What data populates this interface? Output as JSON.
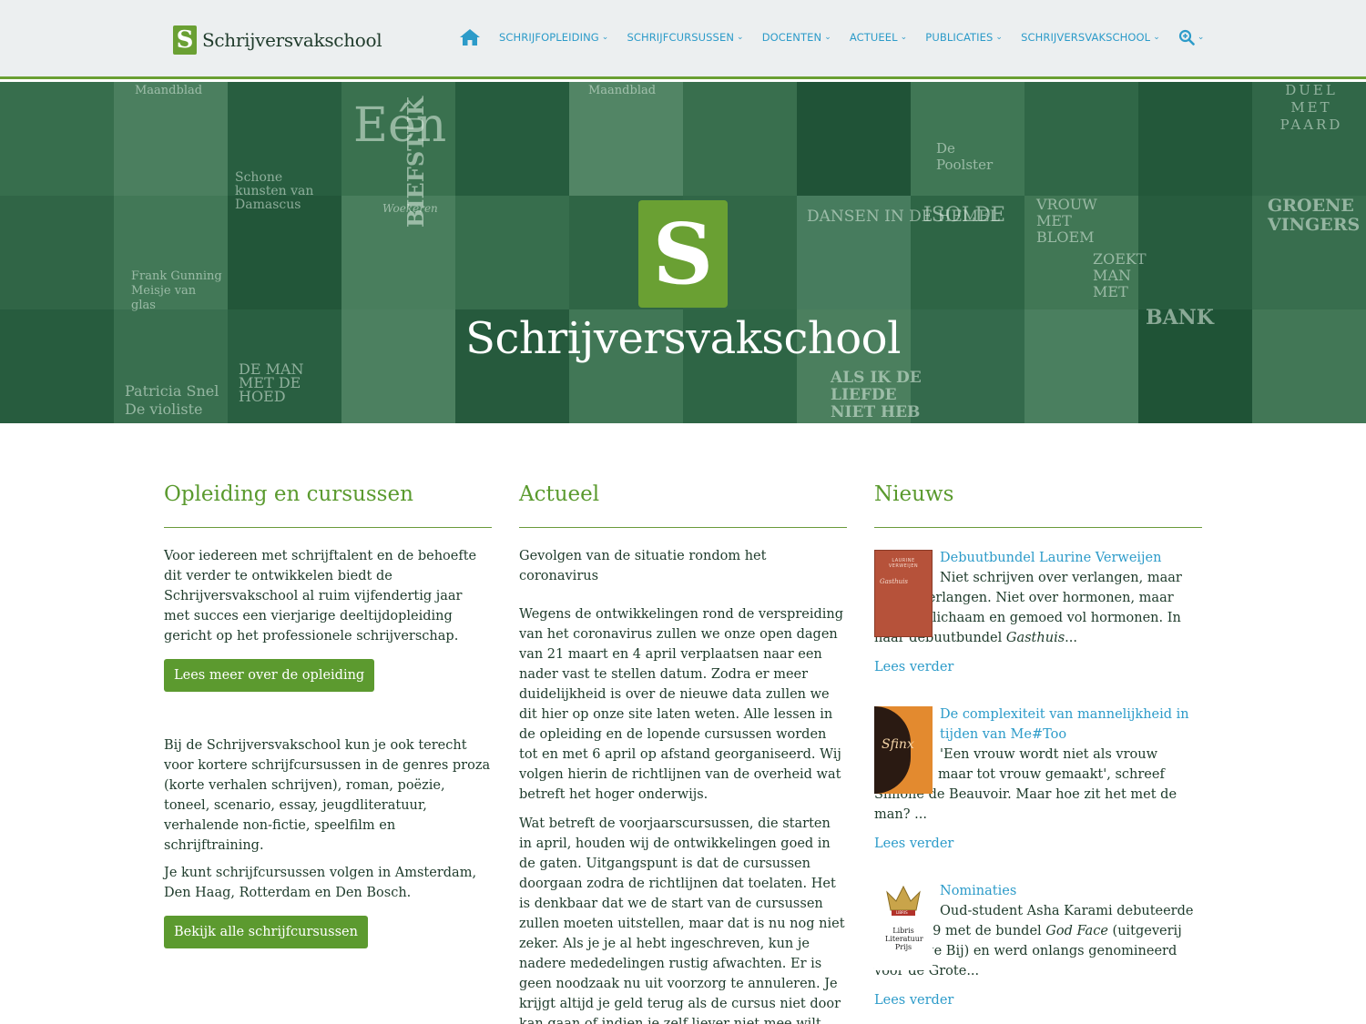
{
  "header": {
    "logo_letter": "S",
    "logo_text": "Schrijversvakschool",
    "nav": [
      {
        "label": "SCHRIJFOPLEIDING"
      },
      {
        "label": "SCHRIJFCURSUSSEN"
      },
      {
        "label": "DOCENTEN"
      },
      {
        "label": "ACTUEEL"
      },
      {
        "label": "PUBLICATIES"
      },
      {
        "label": "SCHRIJVERSVAKSCHOOL"
      }
    ]
  },
  "hero": {
    "logo_letter": "S",
    "title": "Schrijversvakschool",
    "tile_texts": [
      "Maandblad",
      "Eén",
      "Maandblad",
      "Schone kunsten van Damascus",
      "De Poolster",
      "DUEL MET PAARD",
      "Woekeren",
      "BIEFSTUK",
      "DANSEN IN DE HEMEL",
      "ISOLDE",
      "VROUW MET BLOEM",
      "GROENE VINGERS",
      "Frank Gunning Meisje van glas",
      "ZOEKT MAN MET",
      "BANK",
      "Patricia Snel De violiste",
      "DE MAN MET DE HOED",
      "ALS IK DE LIEFDE NIET HEB"
    ]
  },
  "col1": {
    "heading": "Opleiding en cursussen",
    "p1": "Voor iedereen met schrijftalent en de behoefte dit verder te ontwikkelen biedt de Schrijversvakschool al ruim vijfendertig jaar met succes een vierjarige deeltijdopleiding gericht op het professionele schrijverschap.",
    "btn1": "Lees meer over de opleiding",
    "p2": "Bij de Schrijversvakschool kun je ook terecht voor kortere schrijfcursussen in de genres proza (korte verhalen schrijven), roman, poëzie, toneel, scenario, essay, jeugdliteratuur, verhalende non-fictie, speelfilm en schrijftraining.",
    "p3": "Je kunt schrijfcursussen volgen in Amsterdam, Den Haag, Rotterdam en Den Bosch.",
    "btn2": "Bekijk alle schrijfcursussen"
  },
  "col2": {
    "heading": "Actueel",
    "p1": "Gevolgen van de situatie rondom het coronavirus",
    "p2": "Wegens de ontwikkelingen rond de verspreiding van het coronavirus zullen we onze open dagen van 21 maart en 4 april verplaatsen naar een nader vast te stellen datum. Zodra er meer duidelijkheid is over de nieuwe data zullen we dit hier op onze site laten weten. Alle lessen in de opleiding en de lopende cursussen worden tot en met 6 april op afstand georganiseerd. Wij volgen hierin de richtlijnen van de overheid wat betreft het hoger onderwijs.",
    "p3": "Wat betreft de voorjaarscursussen, die starten in april, houden wij de ontwikkelingen goed in de gaten. Uitgangspunt is dat de cursussen doorgaan zodra de richtlijnen dat toelaten. Het is denkbaar dat we de start van de cursussen zullen moeten uitstellen, maar dat is nu nog niet zeker. Als je je al hebt ingeschreven, kun je nadere mededelingen rustig afwachten. Er is geen noodzaak nu uit voorzorg te annuleren. Je krijgt altijd je geld terug als de cursus niet door kan gaan of indien je zelf liever niet mee wilt doen en dit ons ten minste één"
  },
  "col3": {
    "heading": "Nieuws",
    "items": [
      {
        "title": "Debuutbundel Laurine Verweijen",
        "body": "Niet schrijven over verlangen, maar vanuit verlangen. Niet over hormonen, maar met een lichaam en gemoed vol hormonen. In haar debuutbundel ",
        "em": "Gasthuis",
        "tail": "...",
        "more": "Lees verder",
        "thumb_top": "LAURINE VERWEIJEN",
        "thumb_title": "Gasthuis"
      },
      {
        "title": "De complexiteit van mannelijkheid in tijden van Me#Too",
        "body": "'Een vrouw wordt niet als vrouw geboren, maar tot vrouw gemaakt', schreef Simone de Beauvoir. Maar hoe zit het met de man? ...",
        "em": "",
        "tail": "",
        "more": "Lees verder",
        "thumb_title": "Sfinx"
      },
      {
        "title": "Nominaties",
        "body": "Oud-student Asha Karami debuteerde eind 2019 met de bundel ",
        "em": "God Face",
        "tail": " (uitgeverij De Bezige Bij) en werd onlangs genomineerd voor de Grote...",
        "more": "Lees verder",
        "thumb_badge": "LIBRIS",
        "thumb_caption": "Libris Literatuur Prijs"
      }
    ]
  },
  "colors": {
    "green": "#5c9a2f",
    "link": "#2c9bc9",
    "hero": "#2d6b47"
  }
}
